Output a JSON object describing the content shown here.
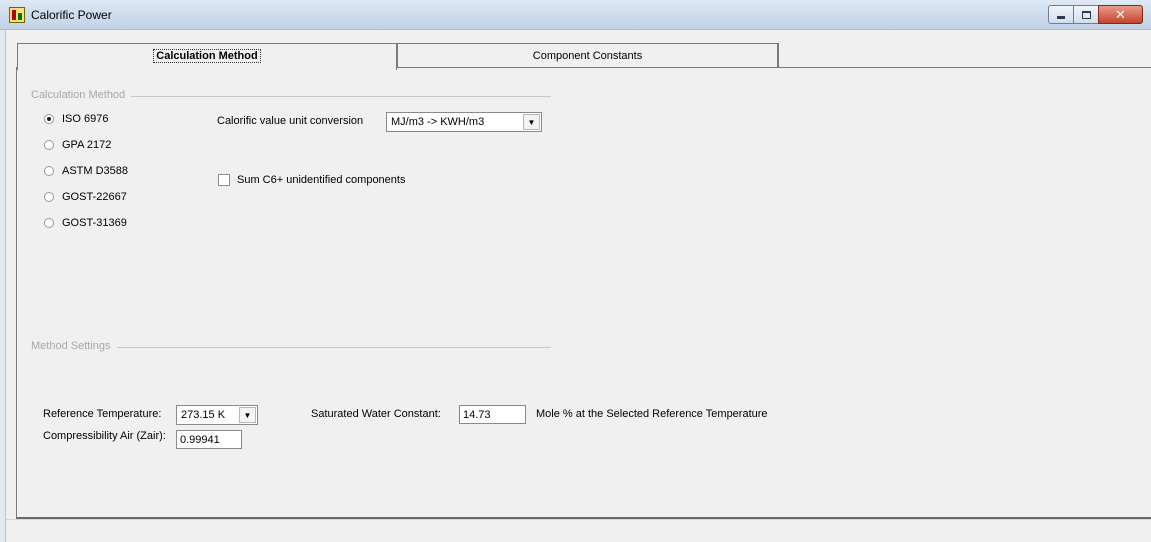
{
  "window": {
    "title": "Calorific Power",
    "icon": "app-chart-icon"
  },
  "tabs": [
    {
      "label": "Calculation Method",
      "active": true
    },
    {
      "label": "Component Constants",
      "active": false
    }
  ],
  "calculation_group": {
    "label": "Calculation Method",
    "methods": [
      {
        "label": "ISO 6976",
        "checked": true
      },
      {
        "label": "GPA 2172",
        "checked": false
      },
      {
        "label": "ASTM D3588",
        "checked": false
      },
      {
        "label": "GOST-22667",
        "checked": false
      },
      {
        "label": "GOST-31369",
        "checked": false
      }
    ],
    "unit_conversion_label": "Calorific value unit conversion",
    "unit_conversion_value": "MJ/m3 -> KWH/m3",
    "sum_c6_label": "Sum C6+ unidentified components",
    "sum_c6_checked": false
  },
  "settings_group": {
    "label": "Method Settings",
    "ref_temp_label": "Reference Temperature:",
    "ref_temp_value": "273.15 K",
    "compress_label": "Compressibility Air (Zair):",
    "compress_value": "0.99941",
    "sat_water_label": "Saturated Water Constant:",
    "sat_water_value": "14.73",
    "sat_water_unit": "Mole % at the Selected Reference Temperature"
  }
}
